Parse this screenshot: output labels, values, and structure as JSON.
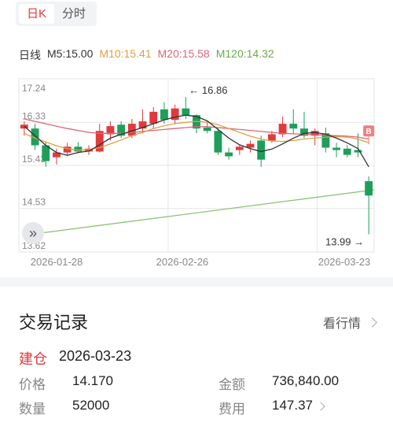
{
  "tabs": [
    {
      "label": "日K",
      "active": true
    },
    {
      "label": "分时",
      "active": false
    }
  ],
  "ma_legend": [
    {
      "label": "日线",
      "color": "#333333"
    },
    {
      "label": "M5:15.00",
      "color": "#333333"
    },
    {
      "label": "M10:15.41",
      "color": "#e0a040"
    },
    {
      "label": "M20:15.58",
      "color": "#d9667a"
    },
    {
      "label": "M120:14.32",
      "color": "#6aab4d"
    }
  ],
  "chart_data": {
    "type": "candlestick",
    "y_tick_labels": [
      "17.24",
      "16.33",
      "15.43",
      "14.53",
      "13.62"
    ],
    "ylim": [
      13.62,
      17.24
    ],
    "x_tick_labels": [
      "2026-01-28",
      "2026-02-26",
      "2026-03-23"
    ],
    "annotations": {
      "max": "16.86",
      "min": "13.99",
      "buy_marker": "B"
    },
    "candles": [
      {
        "o": 16.2,
        "h": 16.35,
        "l": 16.05,
        "c": 16.28
      },
      {
        "o": 16.2,
        "h": 16.3,
        "l": 15.75,
        "c": 15.85
      },
      {
        "o": 15.85,
        "h": 15.92,
        "l": 15.4,
        "c": 15.52
      },
      {
        "o": 15.6,
        "h": 15.78,
        "l": 15.45,
        "c": 15.7
      },
      {
        "o": 15.7,
        "h": 15.9,
        "l": 15.62,
        "c": 15.82
      },
      {
        "o": 15.82,
        "h": 15.92,
        "l": 15.68,
        "c": 15.72
      },
      {
        "o": 15.72,
        "h": 15.85,
        "l": 15.65,
        "c": 15.78
      },
      {
        "o": 15.72,
        "h": 16.3,
        "l": 15.7,
        "c": 16.15
      },
      {
        "o": 16.08,
        "h": 16.35,
        "l": 15.95,
        "c": 16.25
      },
      {
        "o": 16.28,
        "h": 16.35,
        "l": 16.0,
        "c": 16.05
      },
      {
        "o": 16.05,
        "h": 16.4,
        "l": 16.0,
        "c": 16.3
      },
      {
        "o": 16.2,
        "h": 16.6,
        "l": 16.1,
        "c": 16.35
      },
      {
        "o": 16.3,
        "h": 16.65,
        "l": 16.2,
        "c": 16.55
      },
      {
        "o": 16.6,
        "h": 16.75,
        "l": 16.3,
        "c": 16.38
      },
      {
        "o": 16.38,
        "h": 16.7,
        "l": 16.3,
        "c": 16.62
      },
      {
        "o": 16.62,
        "h": 16.86,
        "l": 16.4,
        "c": 16.48
      },
      {
        "o": 16.48,
        "h": 16.5,
        "l": 16.1,
        "c": 16.2
      },
      {
        "o": 16.22,
        "h": 16.35,
        "l": 16.1,
        "c": 16.15
      },
      {
        "o": 16.15,
        "h": 16.22,
        "l": 15.65,
        "c": 15.7
      },
      {
        "o": 15.7,
        "h": 15.8,
        "l": 15.55,
        "c": 15.62
      },
      {
        "o": 15.75,
        "h": 15.85,
        "l": 15.65,
        "c": 15.82
      },
      {
        "o": 15.8,
        "h": 15.95,
        "l": 15.7,
        "c": 15.88
      },
      {
        "o": 15.95,
        "h": 16.05,
        "l": 15.4,
        "c": 15.55
      },
      {
        "o": 15.95,
        "h": 16.15,
        "l": 15.9,
        "c": 16.08
      },
      {
        "o": 16.08,
        "h": 16.45,
        "l": 16.02,
        "c": 16.3
      },
      {
        "o": 16.3,
        "h": 16.6,
        "l": 16.1,
        "c": 16.2
      },
      {
        "o": 16.2,
        "h": 16.55,
        "l": 16.0,
        "c": 16.05
      },
      {
        "o": 16.05,
        "h": 16.2,
        "l": 15.85,
        "c": 16.15
      },
      {
        "o": 16.1,
        "h": 16.22,
        "l": 15.7,
        "c": 15.8
      },
      {
        "o": 15.8,
        "h": 15.9,
        "l": 15.6,
        "c": 15.75
      },
      {
        "o": 15.78,
        "h": 15.85,
        "l": 15.6,
        "c": 15.65
      },
      {
        "o": 15.75,
        "h": 16.1,
        "l": 15.6,
        "c": 15.7
      },
      {
        "o": 15.1,
        "h": 15.2,
        "l": 13.99,
        "c": 14.8
      }
    ],
    "ma5": [
      16.25,
      16.05,
      15.85,
      15.7,
      15.64,
      15.7,
      15.73,
      15.86,
      16.0,
      16.08,
      16.15,
      16.22,
      16.3,
      16.38,
      16.44,
      16.48,
      16.45,
      16.36,
      16.18,
      16.0,
      15.86,
      15.78,
      15.72,
      15.77,
      15.88,
      16.0,
      16.1,
      16.12,
      16.08,
      16.0,
      15.9,
      15.78,
      15.4
    ],
    "ma10": [
      16.1,
      16.0,
      15.92,
      15.84,
      15.78,
      15.75,
      15.76,
      15.8,
      15.88,
      15.96,
      16.05,
      16.12,
      16.2,
      16.26,
      16.3,
      16.33,
      16.35,
      16.33,
      16.28,
      16.2,
      16.12,
      16.04,
      15.98,
      15.94,
      15.93,
      15.95,
      15.98,
      16.0,
      16.02,
      16.03,
      16.02,
      15.98,
      15.9
    ],
    "ma20": [
      16.4,
      16.35,
      16.3,
      16.25,
      16.2,
      16.16,
      16.12,
      16.1,
      16.1,
      16.1,
      16.12,
      16.14,
      16.16,
      16.18,
      16.2,
      16.22,
      16.24,
      16.24,
      16.22,
      16.2,
      16.18,
      16.16,
      16.14,
      16.12,
      16.1,
      16.09,
      16.08,
      16.07,
      16.06,
      16.05,
      16.04,
      16.02,
      15.98
    ],
    "ma120_start": 13.97,
    "ma120_end": 14.92
  },
  "trades": {
    "title": "交易记录",
    "link_label": "看行情",
    "type": "建仓",
    "date": "2026-03-23",
    "price_label": "价格",
    "price": "14.170",
    "amount_label": "金额",
    "amount": "736,840.00",
    "qty_label": "数量",
    "qty": "52000",
    "fee_label": "费用",
    "fee": "147.37"
  },
  "colors": {
    "up": "#e03a3e",
    "down": "#1e9e5a",
    "ma5": "#333333",
    "ma10": "#e0a040",
    "ma20": "#d9667a",
    "ma120": "#8cc470",
    "grid": "#e6e6e6",
    "axis_text": "#888888"
  }
}
